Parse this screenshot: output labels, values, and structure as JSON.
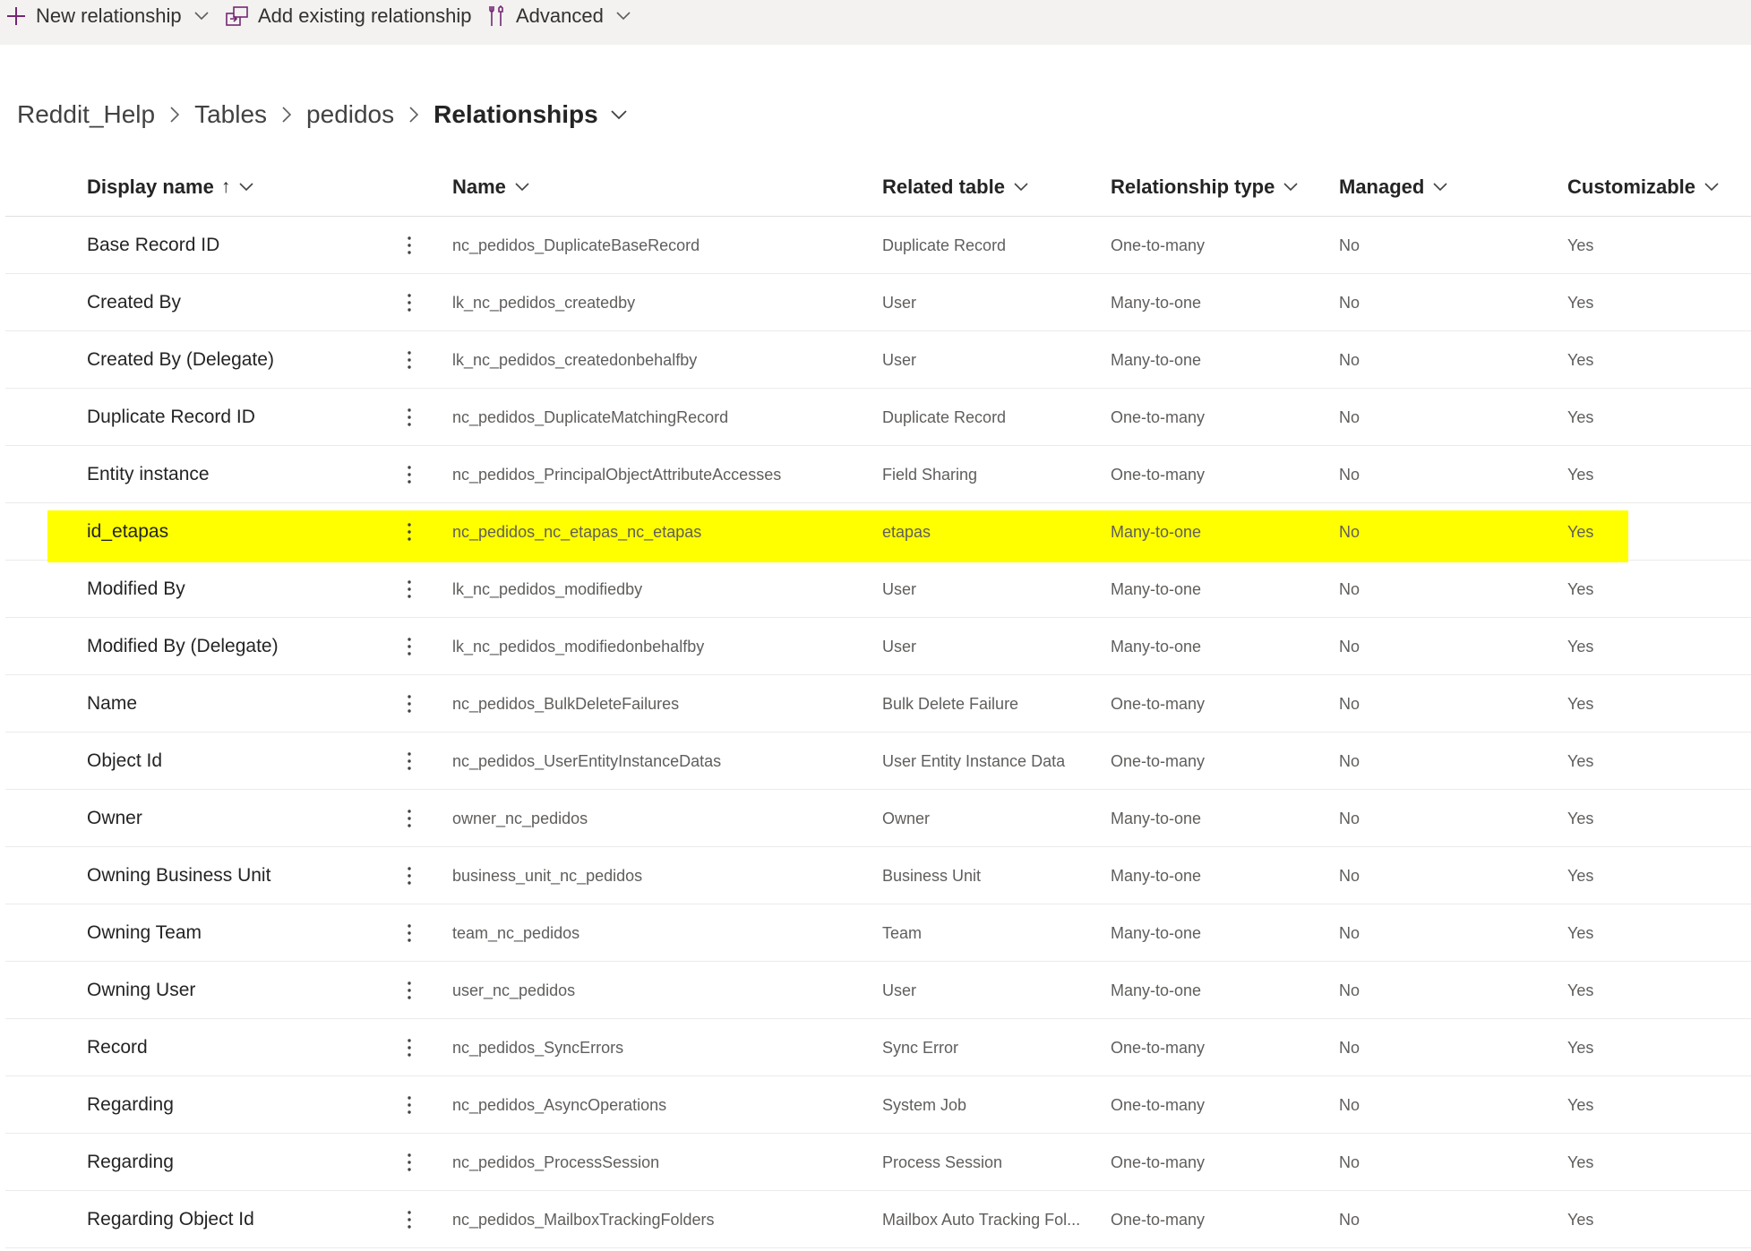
{
  "commandbar": {
    "new_relationship": "New relationship",
    "add_existing": "Add existing relationship",
    "advanced": "Advanced"
  },
  "breadcrumb": {
    "items": [
      "Reddit_Help",
      "Tables",
      "pedidos"
    ],
    "current": "Relationships"
  },
  "table": {
    "columns": {
      "display_name": "Display name",
      "sort_arrow": "↑",
      "name": "Name",
      "related_table": "Related table",
      "relationship_type": "Relationship type",
      "managed": "Managed",
      "customizable": "Customizable"
    },
    "highlight_color": "#ffff00",
    "highlighted_row": 5,
    "rows": [
      {
        "display": "Base Record ID",
        "name": "nc_pedidos_DuplicateBaseRecord",
        "related": "Duplicate Record",
        "type": "One-to-many",
        "managed": "No",
        "custom": "Yes"
      },
      {
        "display": "Created By",
        "name": "lk_nc_pedidos_createdby",
        "related": "User",
        "type": "Many-to-one",
        "managed": "No",
        "custom": "Yes"
      },
      {
        "display": "Created By (Delegate)",
        "name": "lk_nc_pedidos_createdonbehalfby",
        "related": "User",
        "type": "Many-to-one",
        "managed": "No",
        "custom": "Yes"
      },
      {
        "display": "Duplicate Record ID",
        "name": "nc_pedidos_DuplicateMatchingRecord",
        "related": "Duplicate Record",
        "type": "One-to-many",
        "managed": "No",
        "custom": "Yes"
      },
      {
        "display": "Entity instance",
        "name": "nc_pedidos_PrincipalObjectAttributeAccesses",
        "related": "Field Sharing",
        "type": "One-to-many",
        "managed": "No",
        "custom": "Yes"
      },
      {
        "display": "id_etapas",
        "name": "nc_pedidos_nc_etapas_nc_etapas",
        "related": "etapas",
        "type": "Many-to-one",
        "managed": "No",
        "custom": "Yes"
      },
      {
        "display": "Modified By",
        "name": "lk_nc_pedidos_modifiedby",
        "related": "User",
        "type": "Many-to-one",
        "managed": "No",
        "custom": "Yes"
      },
      {
        "display": "Modified By (Delegate)",
        "name": "lk_nc_pedidos_modifiedonbehalfby",
        "related": "User",
        "type": "Many-to-one",
        "managed": "No",
        "custom": "Yes"
      },
      {
        "display": "Name",
        "name": "nc_pedidos_BulkDeleteFailures",
        "related": "Bulk Delete Failure",
        "type": "One-to-many",
        "managed": "No",
        "custom": "Yes"
      },
      {
        "display": "Object Id",
        "name": "nc_pedidos_UserEntityInstanceDatas",
        "related": "User Entity Instance Data",
        "type": "One-to-many",
        "managed": "No",
        "custom": "Yes"
      },
      {
        "display": "Owner",
        "name": "owner_nc_pedidos",
        "related": "Owner",
        "type": "Many-to-one",
        "managed": "No",
        "custom": "Yes"
      },
      {
        "display": "Owning Business Unit",
        "name": "business_unit_nc_pedidos",
        "related": "Business Unit",
        "type": "Many-to-one",
        "managed": "No",
        "custom": "Yes"
      },
      {
        "display": "Owning Team",
        "name": "team_nc_pedidos",
        "related": "Team",
        "type": "Many-to-one",
        "managed": "No",
        "custom": "Yes"
      },
      {
        "display": "Owning User",
        "name": "user_nc_pedidos",
        "related": "User",
        "type": "Many-to-one",
        "managed": "No",
        "custom": "Yes"
      },
      {
        "display": "Record",
        "name": "nc_pedidos_SyncErrors",
        "related": "Sync Error",
        "type": "One-to-many",
        "managed": "No",
        "custom": "Yes"
      },
      {
        "display": "Regarding",
        "name": "nc_pedidos_AsyncOperations",
        "related": "System Job",
        "type": "One-to-many",
        "managed": "No",
        "custom": "Yes"
      },
      {
        "display": "Regarding",
        "name": "nc_pedidos_ProcessSession",
        "related": "Process Session",
        "type": "One-to-many",
        "managed": "No",
        "custom": "Yes"
      },
      {
        "display": "Regarding Object Id",
        "name": "nc_pedidos_MailboxTrackingFolders",
        "related": "Mailbox Auto Tracking Fol...",
        "type": "One-to-many",
        "managed": "No",
        "custom": "Yes"
      }
    ]
  },
  "icons": {
    "new": "plus-icon",
    "add_existing": "link-table-icon",
    "advanced": "wrench-icon",
    "row_more": "more-vertical-icon"
  },
  "colors": {
    "commandbar_bg": "#f3f2f1",
    "accent": "#742774",
    "highlight": "#ffff00"
  }
}
